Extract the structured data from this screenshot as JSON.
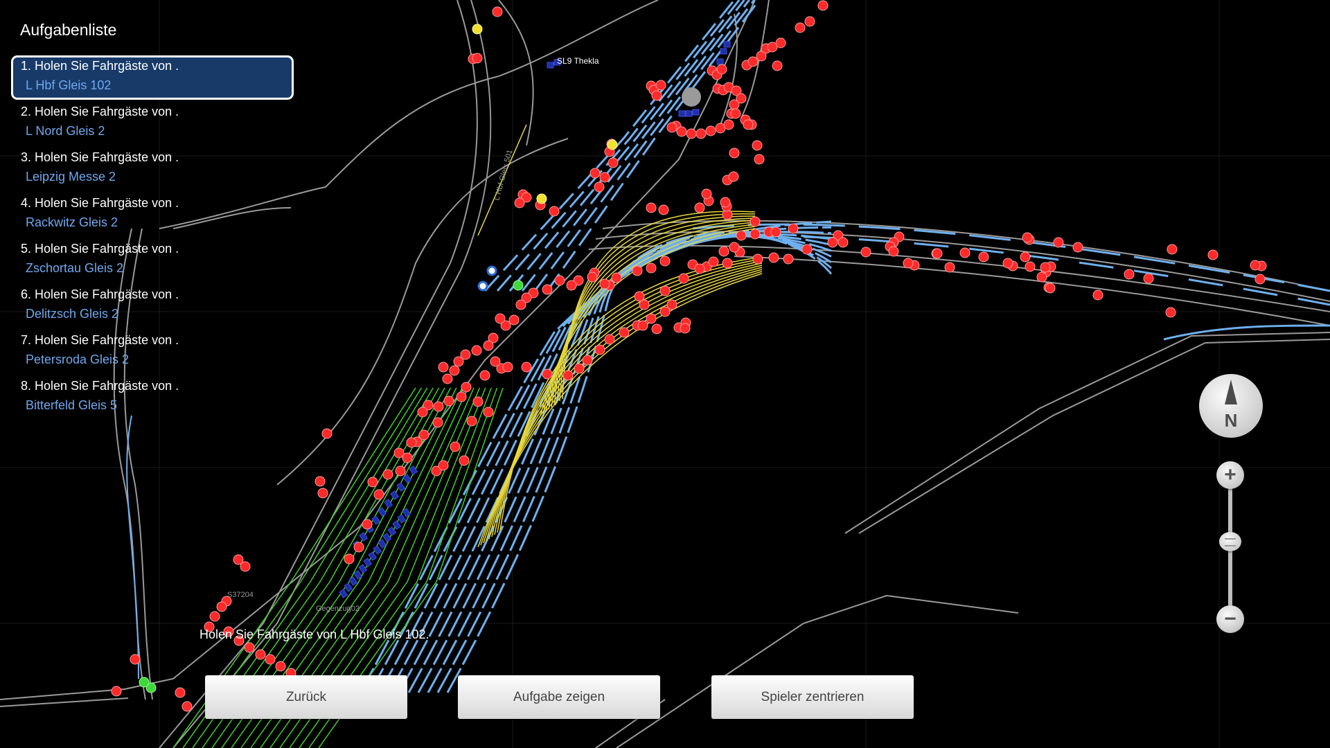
{
  "panel": {
    "title": "Aufgabenliste"
  },
  "tasks": [
    {
      "title": "1. Holen Sie Fahrgäste von  .",
      "station": "L Hbf Gleis 102",
      "selected": true
    },
    {
      "title": "2. Holen Sie Fahrgäste von  .",
      "station": "L Nord Gleis 2"
    },
    {
      "title": "3. Holen Sie Fahrgäste von  .",
      "station": "Leipzig Messe 2"
    },
    {
      "title": "4. Holen Sie Fahrgäste von  .",
      "station": "Rackwitz Gleis 2"
    },
    {
      "title": "5. Holen Sie Fahrgäste von  .",
      "station": "Zschortau Gleis 2"
    },
    {
      "title": "6. Holen Sie Fahrgäste von  .",
      "station": "Delitzsch Gleis 2"
    },
    {
      "title": "7. Holen Sie Fahrgäste von  .",
      "station": "Petersroda Gleis 2"
    },
    {
      "title": "8. Holen Sie Fahrgäste von  .",
      "station": "Bitterfeld Gleis 5"
    }
  ],
  "status_message": "Holen Sie Fahrgäste von  L Hbf Gleis 102.",
  "buttons": {
    "back": "Zurück",
    "show_task": "Aufgabe zeigen",
    "center_player": "Spieler zentrieren"
  },
  "compass": {
    "letter": "N"
  },
  "zoom": {
    "in": "+",
    "out": "−"
  },
  "map_labels": {
    "train_1": "SL9 Thekla",
    "train_2": "Gegenzug02",
    "train_3": "S37204",
    "track_1": "L Hbf Gleis 501"
  },
  "colors": {
    "background": "#000000",
    "track": "#9a9a9a",
    "track_blue": "#6fb0ee",
    "track_yellow": "#e8d83a",
    "track_green": "#3fcf2a",
    "signal_red": "#ff2a2a",
    "task_highlight": "#173a69",
    "station_text": "#6fa8ee"
  }
}
